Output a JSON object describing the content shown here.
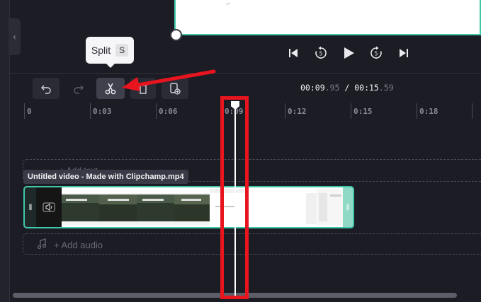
{
  "tooltip": {
    "label": "Split",
    "shortcut": "S"
  },
  "timecode": {
    "current_main": "00:09",
    "current_frac": ".95",
    "separator": "/",
    "total_main": "00:15",
    "total_frac": ".59"
  },
  "ruler": [
    "0",
    "0:03",
    "0:06",
    "0:09",
    "0:12",
    "0:15",
    "0:18"
  ],
  "text_track": {
    "label": "+ Add text"
  },
  "clip": {
    "name": "Untitled video - Made with Clipchamp.mp4"
  },
  "audio_track": {
    "label": "+ Add audio"
  },
  "icons": {
    "undo": "undo-icon",
    "redo": "redo-icon",
    "split": "scissors-icon",
    "delete": "trash-icon",
    "duplicate": "duplicate-icon",
    "skip_back": "skip-back-icon",
    "rewind5": "rewind-5-icon",
    "play": "play-icon",
    "forward5": "forward-5-icon",
    "skip_forward": "skip-forward-icon"
  },
  "colors": {
    "accent": "#3fc7a8",
    "annotation": "#e8141e",
    "background": "#1c1c24"
  }
}
